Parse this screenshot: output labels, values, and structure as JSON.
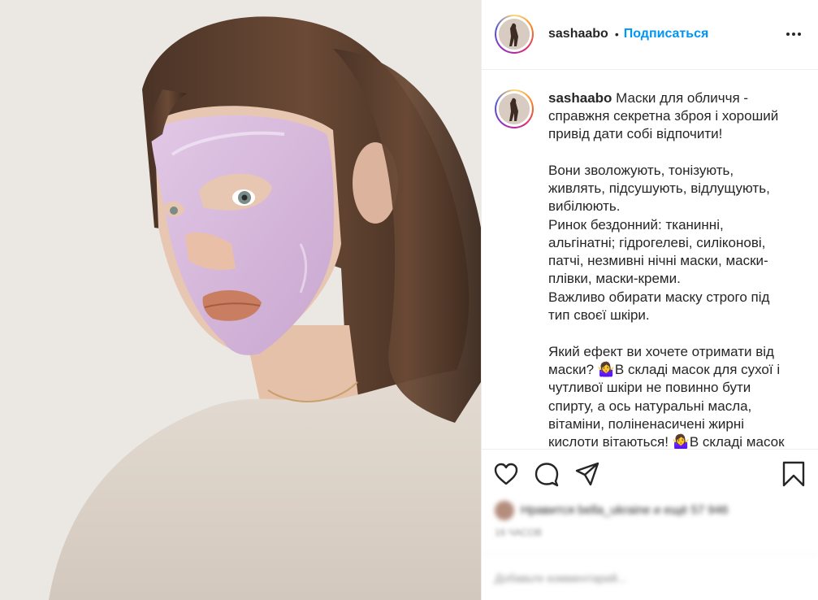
{
  "post": {
    "username": "sashaabo",
    "separator": "•",
    "follow_label": "Подписаться",
    "more_icon": "more-horizontal-icon"
  },
  "caption": {
    "username": "sashaabo",
    "text": "Маски для обличчя -\nсправжня секретна зброя і хороший\nпривід дати собі відпочити!\n\nВони зволожують, тонізують,\nживлять, підсушують, відлущують,\nвибілюють.\nРинок бездонний: тканинні,\nальгінатні; гідрогелеві, силіконові,\nпатчі, незмивні нічні маски, маски-\nплівки, маски-креми.\nВажливо обирати маску строго під\nтип своєї шкіри.\n\nЯкий ефект ви хочете отримати від\nмаски? 🤷‍♀️В складі масок для сухої і\nчутливої шкіри не повинно бути\nспирту, а ось натуральні масла,\nвітаміни, поліненасичені жирні\nкислоти вітаються! 🤷‍♀️В складі масок"
  },
  "actions": {
    "like_icon": "heart-icon",
    "comment_icon": "comment-icon",
    "share_icon": "share-icon",
    "save_icon": "bookmark-icon"
  },
  "likes": {
    "text": "Нравится bella_ukraine и ещё 57 946"
  },
  "timestamp": "16 ЧАСОВ",
  "add_comment_placeholder": "Добавьте комментарий..."
}
